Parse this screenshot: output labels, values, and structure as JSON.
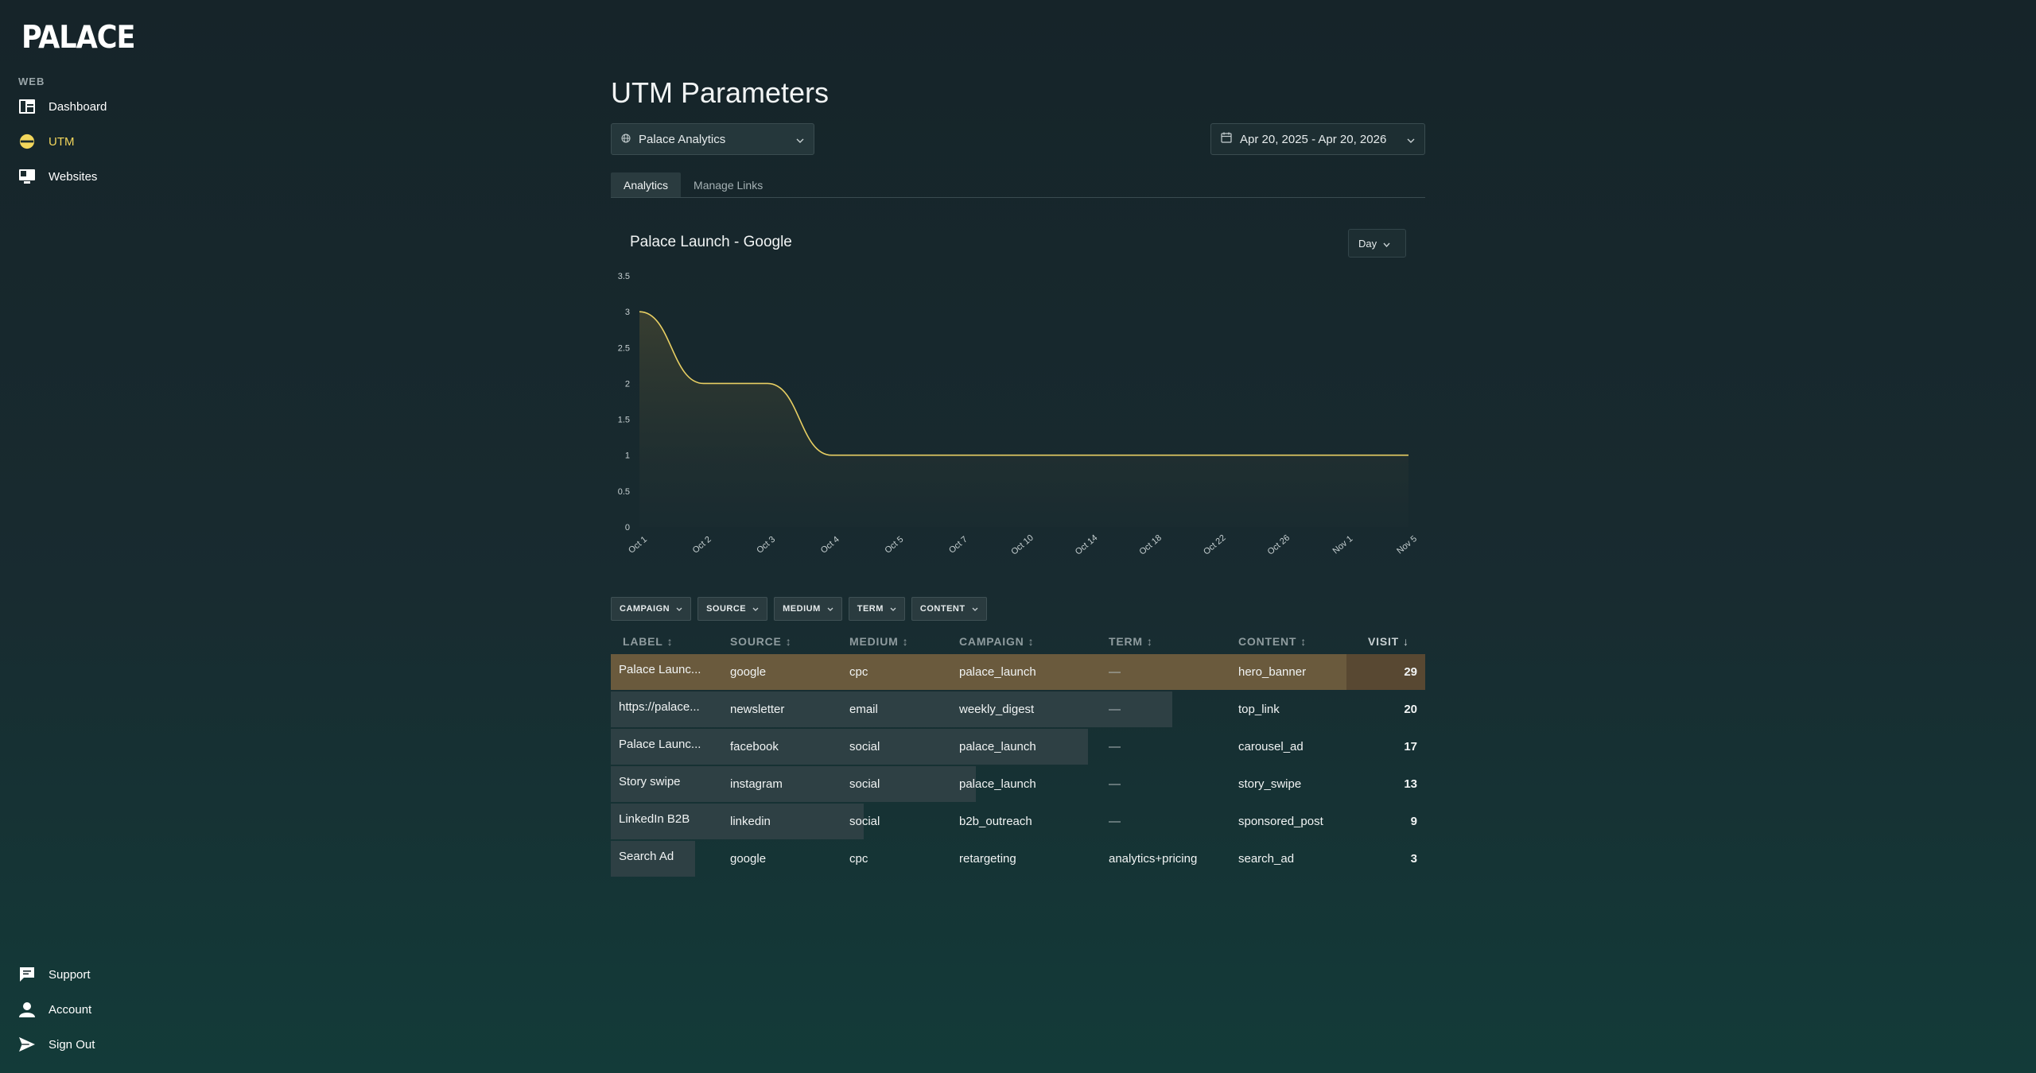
{
  "brand": {
    "logo_text": "PALACE"
  },
  "sidebar": {
    "section_label": "WEB",
    "items": [
      {
        "label": "Dashboard",
        "icon": "dashboard-icon",
        "active": false
      },
      {
        "label": "UTM",
        "icon": "utm-icon",
        "active": true
      },
      {
        "label": "Websites",
        "icon": "monitor-icon",
        "active": false
      }
    ],
    "bottom_items": [
      {
        "label": "Support",
        "icon": "chat-icon"
      },
      {
        "label": "Account",
        "icon": "user-icon"
      },
      {
        "label": "Sign Out",
        "icon": "send-icon"
      }
    ]
  },
  "header": {
    "title": "UTM Parameters",
    "site_select": "Palace Analytics",
    "date_range": "Apr 20, 2025 - Apr 20, 2026"
  },
  "tabs": [
    {
      "label": "Analytics",
      "active": true
    },
    {
      "label": "Manage Links",
      "active": false
    }
  ],
  "chart_header": {
    "title": "Palace Launch - Google",
    "interval": "Day"
  },
  "chart_data": {
    "type": "area",
    "title": "Palace Launch - Google",
    "x": [
      "Oct 1",
      "Oct 2",
      "Oct 3",
      "Oct 4",
      "Oct 5",
      "Oct 7",
      "Oct 10",
      "Oct 14",
      "Oct 18",
      "Oct 22",
      "Oct 26",
      "Nov 1",
      "Nov 5"
    ],
    "values": [
      3,
      2,
      2,
      1,
      1,
      1,
      1,
      1,
      1,
      1,
      1,
      1,
      1
    ],
    "yticks": [
      "0",
      "0.5",
      "1",
      "1.5",
      "2",
      "2.5",
      "3",
      "3.5"
    ],
    "ylim": [
      0,
      3.5
    ],
    "grid": false,
    "line_color": "#e8cf63"
  },
  "filters": [
    "CAMPAIGN",
    "SOURCE",
    "MEDIUM",
    "TERM",
    "CONTENT"
  ],
  "table": {
    "columns": [
      "LABEL",
      "SOURCE",
      "MEDIUM",
      "CAMPAIGN",
      "TERM",
      "CONTENT",
      "VISIT"
    ],
    "rows": [
      {
        "label": "Palace Launc...",
        "source": "google",
        "medium": "cpc",
        "campaign": "palace_launch",
        "term": "—",
        "content": "hero_banner",
        "visit": "29"
      },
      {
        "label": "https://palace...",
        "source": "newsletter",
        "medium": "email",
        "campaign": "weekly_digest",
        "term": "—",
        "content": "top_link",
        "visit": "20"
      },
      {
        "label": "Palace Launc...",
        "source": "facebook",
        "medium": "social",
        "campaign": "palace_launch",
        "term": "—",
        "content": "carousel_ad",
        "visit": "17"
      },
      {
        "label": "Story swipe",
        "source": "instagram",
        "medium": "social",
        "campaign": "palace_launch",
        "term": "—",
        "content": "story_swipe",
        "visit": "13"
      },
      {
        "label": "LinkedIn B2B",
        "source": "linkedin",
        "medium": "social",
        "campaign": "b2b_outreach",
        "term": "—",
        "content": "sponsored_post",
        "visit": "9"
      },
      {
        "label": "Search Ad",
        "source": "google",
        "medium": "cpc",
        "campaign": "retargeting",
        "term": "analytics+pricing",
        "content": "search_ad",
        "visit": "3"
      }
    ]
  }
}
